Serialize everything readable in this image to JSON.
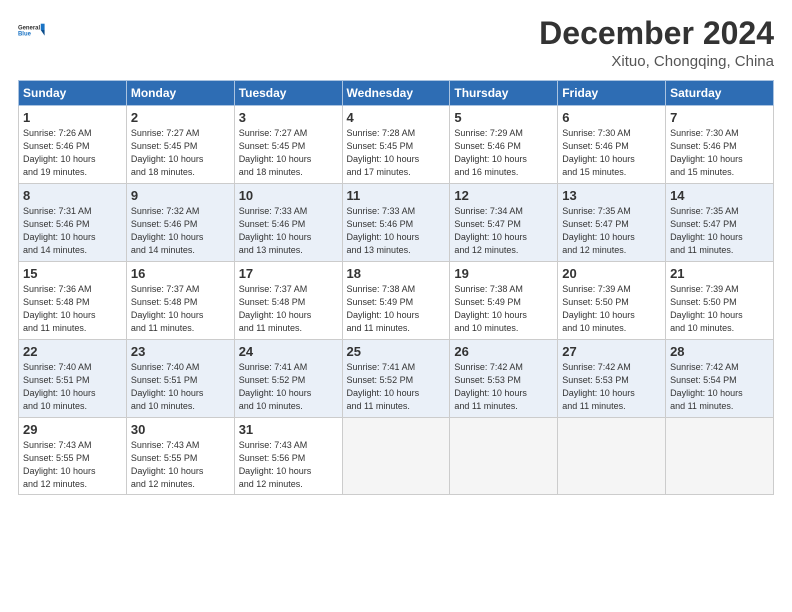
{
  "logo": {
    "line1": "General",
    "line2": "Blue"
  },
  "title": "December 2024",
  "location": "Xituo, Chongqing, China",
  "weekdays": [
    "Sunday",
    "Monday",
    "Tuesday",
    "Wednesday",
    "Thursday",
    "Friday",
    "Saturday"
  ],
  "weeks": [
    [
      {
        "day": "1",
        "info": "Sunrise: 7:26 AM\nSunset: 5:46 PM\nDaylight: 10 hours\nand 19 minutes."
      },
      {
        "day": "2",
        "info": "Sunrise: 7:27 AM\nSunset: 5:45 PM\nDaylight: 10 hours\nand 18 minutes."
      },
      {
        "day": "3",
        "info": "Sunrise: 7:27 AM\nSunset: 5:45 PM\nDaylight: 10 hours\nand 18 minutes."
      },
      {
        "day": "4",
        "info": "Sunrise: 7:28 AM\nSunset: 5:45 PM\nDaylight: 10 hours\nand 17 minutes."
      },
      {
        "day": "5",
        "info": "Sunrise: 7:29 AM\nSunset: 5:46 PM\nDaylight: 10 hours\nand 16 minutes."
      },
      {
        "day": "6",
        "info": "Sunrise: 7:30 AM\nSunset: 5:46 PM\nDaylight: 10 hours\nand 15 minutes."
      },
      {
        "day": "7",
        "info": "Sunrise: 7:30 AM\nSunset: 5:46 PM\nDaylight: 10 hours\nand 15 minutes."
      }
    ],
    [
      {
        "day": "8",
        "info": "Sunrise: 7:31 AM\nSunset: 5:46 PM\nDaylight: 10 hours\nand 14 minutes."
      },
      {
        "day": "9",
        "info": "Sunrise: 7:32 AM\nSunset: 5:46 PM\nDaylight: 10 hours\nand 14 minutes."
      },
      {
        "day": "10",
        "info": "Sunrise: 7:33 AM\nSunset: 5:46 PM\nDaylight: 10 hours\nand 13 minutes."
      },
      {
        "day": "11",
        "info": "Sunrise: 7:33 AM\nSunset: 5:46 PM\nDaylight: 10 hours\nand 13 minutes."
      },
      {
        "day": "12",
        "info": "Sunrise: 7:34 AM\nSunset: 5:47 PM\nDaylight: 10 hours\nand 12 minutes."
      },
      {
        "day": "13",
        "info": "Sunrise: 7:35 AM\nSunset: 5:47 PM\nDaylight: 10 hours\nand 12 minutes."
      },
      {
        "day": "14",
        "info": "Sunrise: 7:35 AM\nSunset: 5:47 PM\nDaylight: 10 hours\nand 11 minutes."
      }
    ],
    [
      {
        "day": "15",
        "info": "Sunrise: 7:36 AM\nSunset: 5:48 PM\nDaylight: 10 hours\nand 11 minutes."
      },
      {
        "day": "16",
        "info": "Sunrise: 7:37 AM\nSunset: 5:48 PM\nDaylight: 10 hours\nand 11 minutes."
      },
      {
        "day": "17",
        "info": "Sunrise: 7:37 AM\nSunset: 5:48 PM\nDaylight: 10 hours\nand 11 minutes."
      },
      {
        "day": "18",
        "info": "Sunrise: 7:38 AM\nSunset: 5:49 PM\nDaylight: 10 hours\nand 11 minutes."
      },
      {
        "day": "19",
        "info": "Sunrise: 7:38 AM\nSunset: 5:49 PM\nDaylight: 10 hours\nand 10 minutes."
      },
      {
        "day": "20",
        "info": "Sunrise: 7:39 AM\nSunset: 5:50 PM\nDaylight: 10 hours\nand 10 minutes."
      },
      {
        "day": "21",
        "info": "Sunrise: 7:39 AM\nSunset: 5:50 PM\nDaylight: 10 hours\nand 10 minutes."
      }
    ],
    [
      {
        "day": "22",
        "info": "Sunrise: 7:40 AM\nSunset: 5:51 PM\nDaylight: 10 hours\nand 10 minutes."
      },
      {
        "day": "23",
        "info": "Sunrise: 7:40 AM\nSunset: 5:51 PM\nDaylight: 10 hours\nand 10 minutes."
      },
      {
        "day": "24",
        "info": "Sunrise: 7:41 AM\nSunset: 5:52 PM\nDaylight: 10 hours\nand 10 minutes."
      },
      {
        "day": "25",
        "info": "Sunrise: 7:41 AM\nSunset: 5:52 PM\nDaylight: 10 hours\nand 11 minutes."
      },
      {
        "day": "26",
        "info": "Sunrise: 7:42 AM\nSunset: 5:53 PM\nDaylight: 10 hours\nand 11 minutes."
      },
      {
        "day": "27",
        "info": "Sunrise: 7:42 AM\nSunset: 5:53 PM\nDaylight: 10 hours\nand 11 minutes."
      },
      {
        "day": "28",
        "info": "Sunrise: 7:42 AM\nSunset: 5:54 PM\nDaylight: 10 hours\nand 11 minutes."
      }
    ],
    [
      {
        "day": "29",
        "info": "Sunrise: 7:43 AM\nSunset: 5:55 PM\nDaylight: 10 hours\nand 12 minutes."
      },
      {
        "day": "30",
        "info": "Sunrise: 7:43 AM\nSunset: 5:55 PM\nDaylight: 10 hours\nand 12 minutes."
      },
      {
        "day": "31",
        "info": "Sunrise: 7:43 AM\nSunset: 5:56 PM\nDaylight: 10 hours\nand 12 minutes."
      },
      {
        "day": "",
        "info": ""
      },
      {
        "day": "",
        "info": ""
      },
      {
        "day": "",
        "info": ""
      },
      {
        "day": "",
        "info": ""
      }
    ]
  ]
}
